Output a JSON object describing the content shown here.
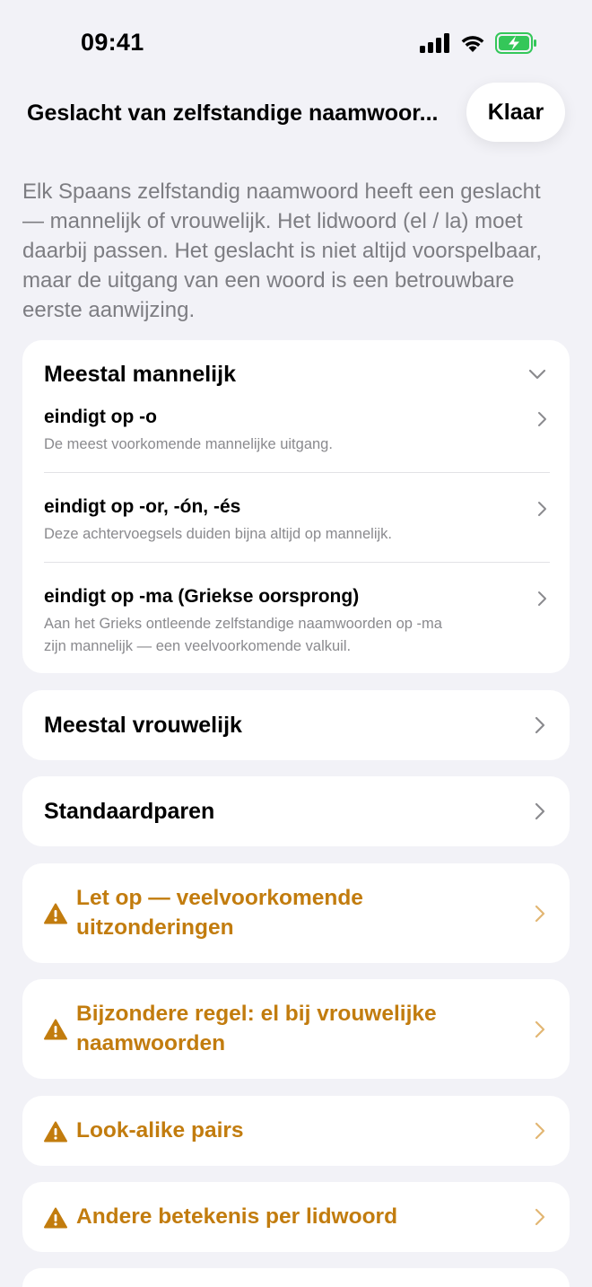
{
  "status_bar": {
    "time": "09:41",
    "icons": [
      "cellular-signal-icon",
      "wifi-icon",
      "battery-charging-icon"
    ]
  },
  "header": {
    "title": "Geslacht van zelfstandige naamwoor...",
    "done_label": "Klaar"
  },
  "intro": "Elk Spaans zelfstandig naamwoord heeft een geslacht — mannelijk of vrouwelijk. Het lidwoord (el / la) moet daarbij passen. Het geslacht is niet altijd voorspelbaar, maar de uitgang van een woord is een betrouwbare eerste aanwijzing.",
  "sections": {
    "masculine": {
      "title": "Meestal mannelijk",
      "expanded": true,
      "rules": [
        {
          "title": "eindigt op -o",
          "desc": "De meest voorkomende mannelijke uitgang."
        },
        {
          "title": "eindigt op -or, -ón, -és",
          "desc": "Deze achtervoegsels duiden bijna altijd op mannelijk."
        },
        {
          "title": "eindigt op -ma (Griekse oorsprong)",
          "desc_line1": "Aan het Grieks ontleende zelfstandige naamwoorden op -ma",
          "desc_line2": "zijn mannelijk — een veelvoorkomende valkuil."
        }
      ]
    },
    "feminine": {
      "title": "Meestal vrouwelijk"
    },
    "pairs": {
      "title": "Standaardparen"
    },
    "warnings": [
      {
        "line1": "Let op — veelvoorkomende",
        "line2": "uitzonderingen"
      },
      {
        "line1": "Bijzondere regel: el bij vrouwelijke",
        "line2": "naamwoorden"
      },
      {
        "line1": "Look-alike pairs"
      },
      {
        "line1": "Andere betekenis per lidwoord"
      }
    ]
  },
  "colors": {
    "background": "#f2f2f7",
    "card": "#ffffff",
    "warning": "#c27c0e",
    "secondary_text": "#8a8a8e",
    "battery": "#34c759"
  }
}
